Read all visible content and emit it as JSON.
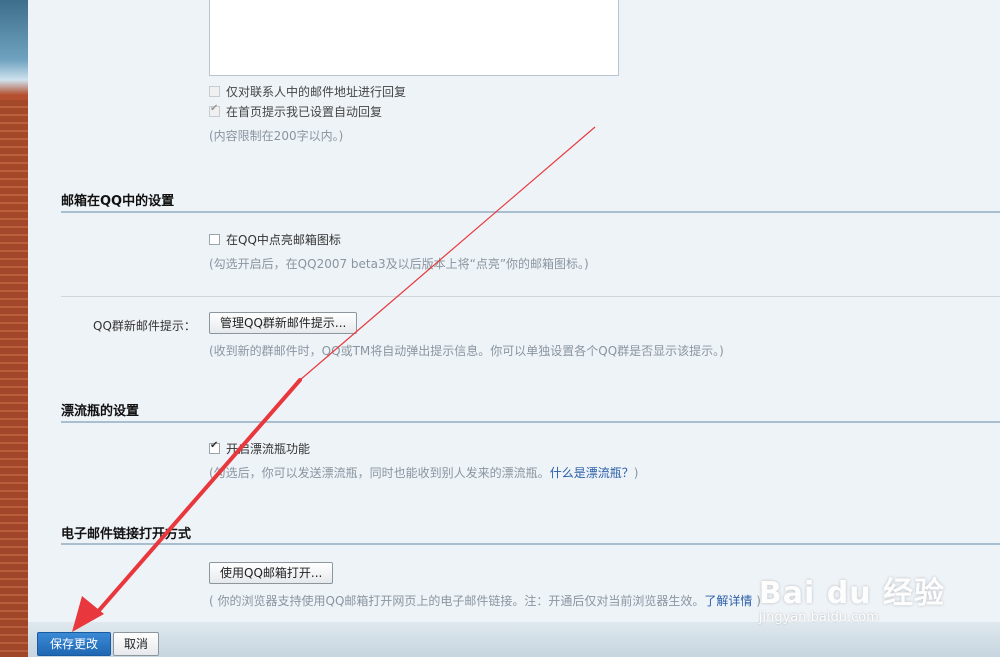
{
  "auto_reply": {
    "only_contacts_label": "仅对联系人中的邮件地址进行回复",
    "only_contacts_checked": false,
    "show_on_home_label": "在首页提示我已设置自动回复",
    "show_on_home_checked": true,
    "limit_hint": "(内容限制在200字以内。)"
  },
  "qq_settings": {
    "title": "邮箱在QQ中的设置",
    "light_icon_label": "在QQ中点亮邮箱图标",
    "light_icon_checked": false,
    "light_icon_hint": "(勾选开启后，在QQ2007 beta3及以后版本上将“点亮”你的邮箱图标。)",
    "group_label": "QQ群新邮件提示：",
    "group_button": "管理QQ群新邮件提示...",
    "group_hint": "(收到新的群邮件时，QQ或TM将自动弹出提示信息。你可以单独设置各个QQ群是否显示该提示。)"
  },
  "drift_bottle": {
    "title": "漂流瓶的设置",
    "enable_label": "开启漂流瓶功能",
    "enable_checked": true,
    "hint_prefix": "(勾选后，你可以发送漂流瓶，同时也能收到别人发来的漂流瓶。",
    "hint_link": "什么是漂流瓶？",
    "hint_suffix": ")"
  },
  "mail_link": {
    "title": "电子邮件链接打开方式",
    "button": "使用QQ邮箱打开...",
    "hint_prefix": "( 你的浏览器支持使用QQ邮箱打开网页上的电子邮件链接。注：开通后仅对当前浏览器生效。",
    "hint_link": "了解详情",
    "hint_suffix": " )"
  },
  "footer": {
    "save_label": "保存更改",
    "cancel_label": "取消"
  },
  "watermark": {
    "logo": "Bai du 经验",
    "url": "jingyan.baidu.com"
  },
  "colors": {
    "accent": "#1f67b3",
    "arrow": "#e8383d",
    "link": "#2a5ea8"
  }
}
